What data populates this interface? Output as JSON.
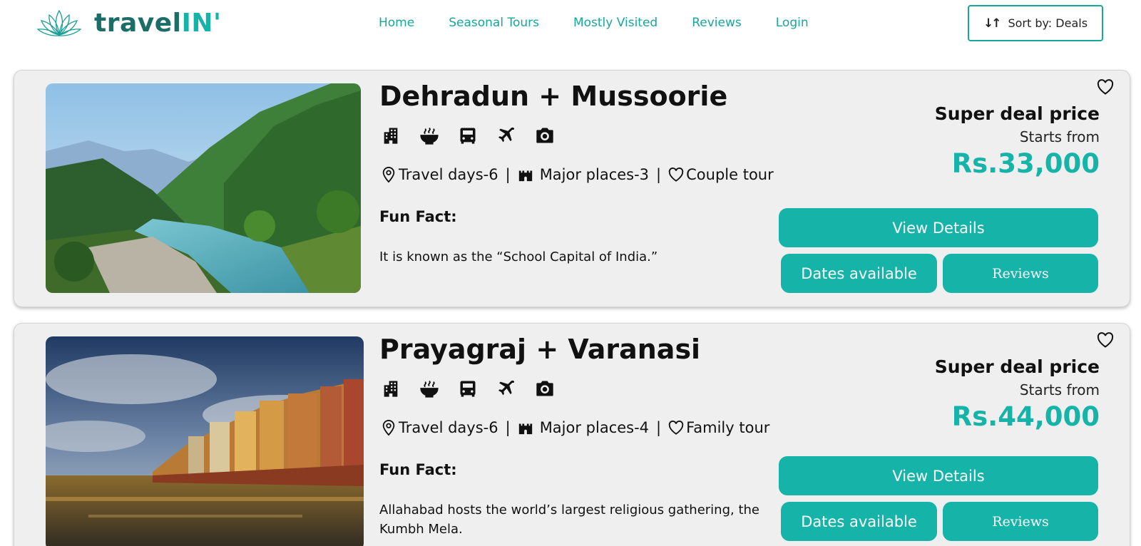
{
  "header": {
    "logo": {
      "text_main": "travel",
      "text_accent": "IN'",
      "icon": "lotus-icon"
    },
    "nav": [
      "Home",
      "Seasonal Tours",
      "Mostly Visited",
      "Reviews",
      "Login"
    ],
    "sort_button": {
      "label": "Sort by: Deals",
      "icon": "sort-arrows-icon"
    }
  },
  "colors": {
    "accent": "#16b3a9",
    "logo_dark": "#1b6e68",
    "card_bg": "#efefef"
  },
  "amenity_icons": [
    "hotel-icon",
    "meal-bowl-icon",
    "bus-icon",
    "plane-icon",
    "camera-icon"
  ],
  "tours": [
    {
      "title": "Dehradun + Mussoorie",
      "travel_days": "Travel days-6",
      "major_places": "Major places-3",
      "tour_type": "Couple tour",
      "fun_fact_label": "Fun Fact:",
      "fun_fact": "It is known as the “School Capital of India.”",
      "price_title": "Super deal price",
      "price_sub": "Starts from",
      "price": "Rs.33,000",
      "view_label": "View Details",
      "dates_label": "Dates available",
      "reviews_label": "Reviews"
    },
    {
      "title": "Prayagraj + Varanasi",
      "travel_days": "Travel days-6",
      "major_places": "Major places-4",
      "tour_type": "Family tour",
      "fun_fact_label": "Fun Fact:",
      "fun_fact": "Allahabad hosts the world’s largest religious gathering, the Kumbh Mela.",
      "price_title": "Super deal price",
      "price_sub": "Starts from",
      "price": "Rs.44,000",
      "view_label": "View Details",
      "dates_label": "Dates available",
      "reviews_label": "Reviews"
    }
  ]
}
